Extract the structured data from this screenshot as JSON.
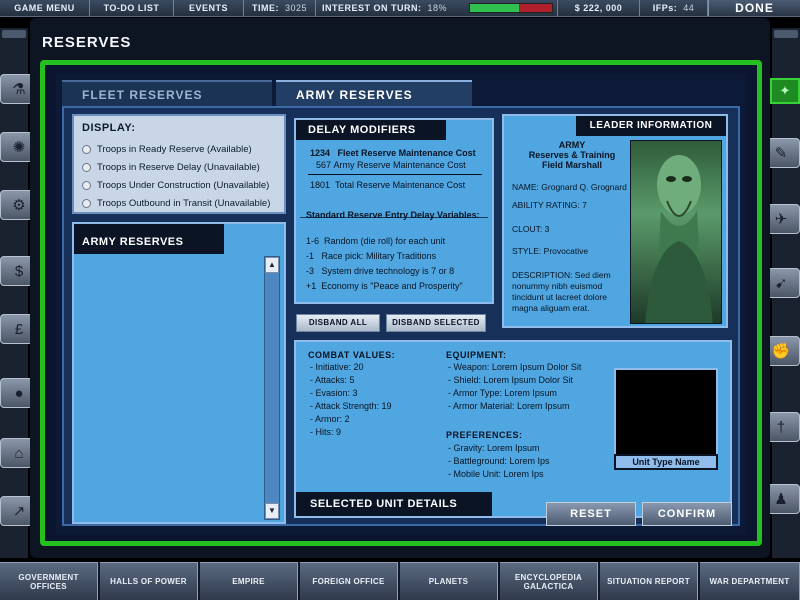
{
  "topbar": {
    "game_menu": "GAME MENU",
    "todo": "TO-DO LIST",
    "events": "EVENTS",
    "time_label": "TIME:",
    "time_value": "3025",
    "interest_label": "INTEREST ON TURN:",
    "interest_value": "18%",
    "interest_fraction": 0.6,
    "money": "$ 222, 000",
    "ifps_label": "IFPs:",
    "ifps_value": "44",
    "done": "DONE"
  },
  "page_title": "RESERVES",
  "tabs": {
    "fleet": "FLEET RESERVES",
    "army": "ARMY RESERVES"
  },
  "display": {
    "title": "DISPLAY:",
    "options": [
      "Troops in Ready Reserve (Available)",
      "Troops in Reserve Delay (Unavailable)",
      "Troops Under Construction (Unavailable)",
      "Troops Outbound in Transit (Unavailable)"
    ]
  },
  "army_list": {
    "title": "ARMY RESERVES"
  },
  "delay": {
    "title": "DELAY MODIFIERS",
    "fleet_cost_value": "1234",
    "fleet_cost_label": "Fleet Reserve Maintenance Cost",
    "army_cost_value": "567",
    "army_cost_label": "Army Reserve Maintenance Cost",
    "total_value": "1801",
    "total_label": "Total Reserve Maintenance Cost",
    "vars_title": "Standard Reserve Entry Delay Variables:",
    "vars": [
      {
        "mod": "1-6",
        "text": "Random (die roll) for each unit"
      },
      {
        "mod": "-1",
        "text": "Race pick:  Military Traditions"
      },
      {
        "mod": "-3",
        "text": "System drive technology is 7 or 8"
      },
      {
        "mod": "+1",
        "text": "Economy is \"Peace and Prosperity\""
      }
    ]
  },
  "leader": {
    "title": "LEADER INFORMATION",
    "unit_line1": "ARMY",
    "unit_line2": "Reserves & Training",
    "unit_line3": "Field Marshall",
    "name": "NAME: Grognard Q. Grognard",
    "ability": "ABILITY RATING: 7",
    "clout": "CLOUT: 3",
    "style": "STYLE: Provocative",
    "description": "DESCRIPTION: Sed diem nonummy nibh euismod tincidunt ut lacreet dolore magna aliguam erat."
  },
  "buttons": {
    "disband_all": "DISBAND ALL",
    "disband_selected": "DISBAND SELECTED",
    "reset": "RESET",
    "confirm": "CONFIRM"
  },
  "unit": {
    "footer": "SELECTED UNIT DETAILS",
    "combat_title": "COMBAT VALUES:",
    "combat": [
      "- Initiative:  20",
      "- Attacks:  5",
      "- Evasion:  3",
      "- Attack Strength:  19",
      "- Armor:  2",
      "- Hits:  9"
    ],
    "equipment_title": "EQUIPMENT:",
    "equipment": [
      "- Weapon: Lorem Ipsum Dolor Sit",
      "- Shield: Lorem Ipsum Dolor Sit",
      "- Armor Type:  Lorem Ipsum",
      "- Armor Material:  Lorem Ipsum"
    ],
    "preferences_title": "PREFERENCES:",
    "preferences": [
      "- Gravity:  Lorem Ipsum",
      "- Battleground: Lorem Ips",
      "- Mobile Unit:  Lorem Ips"
    ],
    "type_name": "Unit Type Name"
  },
  "bottom_nav": [
    "GOVERNMENT OFFICES",
    "HALLS OF POWER",
    "EMPIRE",
    "FOREIGN OFFICE",
    "PLANETS",
    "ENCYCLOPEDIA GALACTICA",
    "SITUATION REPORT",
    "WAR DEPARTMENT"
  ],
  "left_icons": [
    "flask-icon",
    "brain-icon",
    "gears-icon",
    "dollar-icon",
    "pound-icon",
    "planets-icon",
    "factory-icon",
    "graph-icon"
  ],
  "right_icons": [
    "wrench-icon",
    "fighter-icon",
    "fleet-icon",
    "fist-icon",
    "sword-icon",
    "chess-piece-icon"
  ],
  "colors": {
    "accent_green": "#24c020",
    "panel_blue": "#4fa6e0",
    "interest_good": "#30c050",
    "interest_bad": "#b0202c"
  }
}
